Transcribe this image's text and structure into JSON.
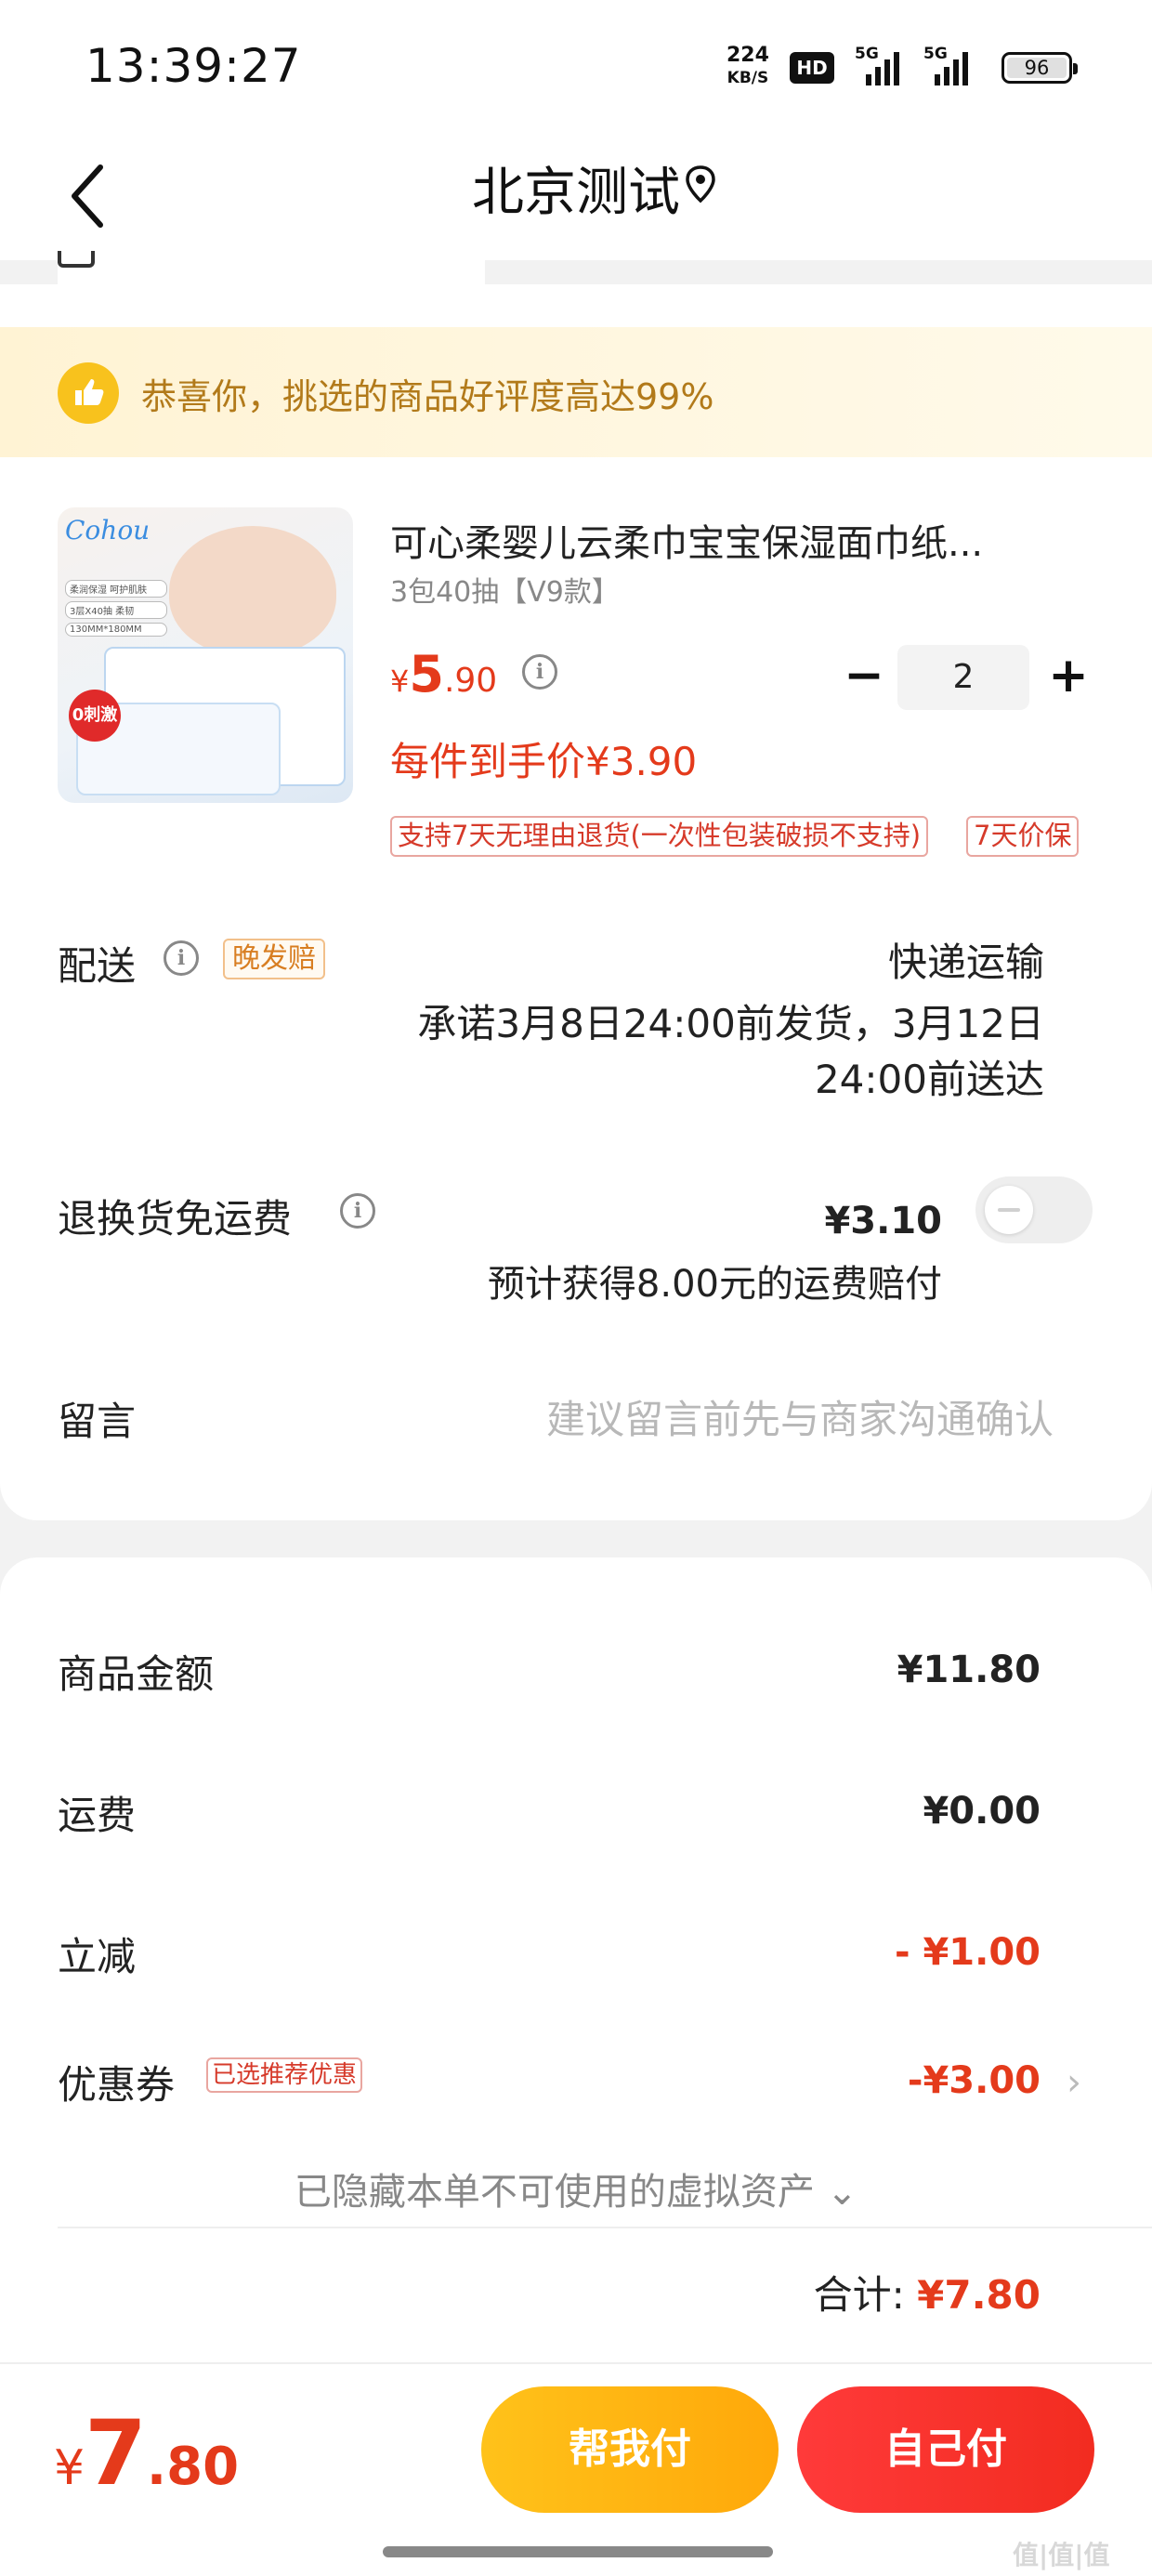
{
  "status_bar": {
    "time": "13:39:27",
    "speed_value": "224",
    "speed_unit": "KB/S",
    "hd": "HD",
    "signal1": "5G",
    "signal2": "5G",
    "battery": "96"
  },
  "nav": {
    "title": "北京测试",
    "icons": {
      "back": "chevron-left-icon",
      "location": "location-pin-icon"
    }
  },
  "banner": {
    "text": "恭喜你，挑选的商品好评度高达99%",
    "icon": "thumbs-up-icon",
    "colors": {
      "bg": "#fff3d4",
      "text": "#b27a1a",
      "icon_bg": "#f8c21d"
    }
  },
  "product": {
    "name": "可心柔婴儿云柔巾宝宝保湿面巾纸...",
    "spec": "3包40抽【V9款】",
    "price_currency": "¥",
    "price_int": "5",
    "price_dec": ".90",
    "quantity": "2",
    "arrival_price": "每件到手价¥3.90",
    "service_tags": [
      "支持7天无理由退货(一次性包装破损不支持)",
      "7天价保"
    ],
    "image": {
      "logo": "Cohou",
      "badge": "0刺激",
      "tags": [
        "柔润保湿 呵护肌肤",
        "3层X40抽 柔韧",
        "130MM*180MM"
      ]
    }
  },
  "delivery": {
    "label": "配送",
    "tag": "晚发赔",
    "method": "快递运输",
    "promise_line1": "承诺3月8日24:00前发货，3月12日",
    "promise_line2": "24:00前送达"
  },
  "return_shipping": {
    "label": "退换货免运费",
    "price": "¥3.10",
    "note": "预计获得8.00元的运费赔付",
    "enabled": false
  },
  "message": {
    "label": "留言",
    "placeholder": "建议留言前先与商家沟通确认"
  },
  "summary": {
    "items": [
      {
        "label": "商品金额",
        "value": "¥11.80"
      },
      {
        "label": "运费",
        "value": "¥0.00"
      },
      {
        "label": "立减",
        "value": "- ¥1.00"
      },
      {
        "label": "优惠券",
        "value": "-¥3.00",
        "tag": "已选推荐优惠"
      }
    ],
    "hidden_assets": "已隐藏本单不可使用的虚拟资产 ⌄",
    "total_label": "合计:",
    "total_value": "¥7.80"
  },
  "bottom": {
    "currency": "¥",
    "int": "7",
    "dec": ".80",
    "btn_help": "帮我付",
    "btn_self": "自己付",
    "colors": {
      "accent_red": "#e43a1b",
      "btn_yellow": "#ffb812",
      "btn_red": "#f23030"
    }
  },
  "watermark": "值|值|值"
}
